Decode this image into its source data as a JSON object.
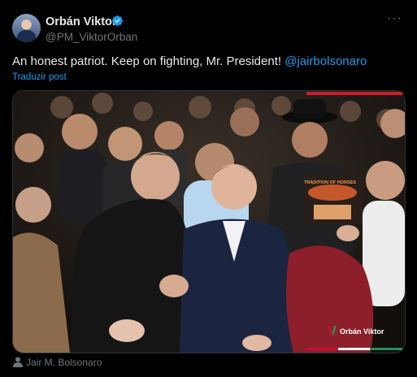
{
  "author": {
    "name": "Orbán Viktor",
    "handle": "@PM_ViktorOrban"
  },
  "menu": {
    "more_label": "···"
  },
  "tweet": {
    "text": "An honest patriot. Keep on fighting, Mr. President! ",
    "mention": "@jairbolsonaro",
    "translate_label": "Traduzir post"
  },
  "media": {
    "watermark": "Orbán Viktor",
    "shirt_print": "TRADITION OF HORSES",
    "tagged_person": "Jair M. Bolsonaro"
  },
  "colors": {
    "link": "#1d9bf0",
    "muted": "#71767b",
    "text": "#e7e9ea",
    "verified": "#1d9bf0",
    "flag_red": "#c8102e",
    "flag_green": "#2e8b57"
  },
  "icons": [
    "verified-badge-icon",
    "more-options-icon",
    "person-tag-icon",
    "watermark-logo-icon"
  ]
}
